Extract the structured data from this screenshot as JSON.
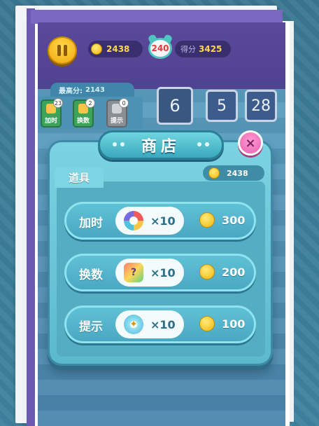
{
  "top_bar": {
    "coins": "2438",
    "timer": "240",
    "score_label": "得分",
    "score": "3425"
  },
  "best_score": {
    "label": "最高分:",
    "value": "2143"
  },
  "tools": [
    {
      "label": "加时",
      "count": "23"
    },
    {
      "label": "换数",
      "count": "2"
    },
    {
      "label": "提示",
      "count": "0"
    }
  ],
  "tiles": [
    "6",
    "5",
    "28"
  ],
  "shop": {
    "title": "商店",
    "close": "×",
    "tab": "道具",
    "coins": "2438",
    "items": [
      {
        "name": "加时",
        "qty": "×10",
        "price": "300",
        "icon": "clock-icon"
      },
      {
        "name": "换数",
        "qty": "×10",
        "price": "200",
        "icon": "swap-card-icon"
      },
      {
        "name": "提示",
        "qty": "×10",
        "price": "100",
        "icon": "lightbulb-icon"
      }
    ]
  }
}
